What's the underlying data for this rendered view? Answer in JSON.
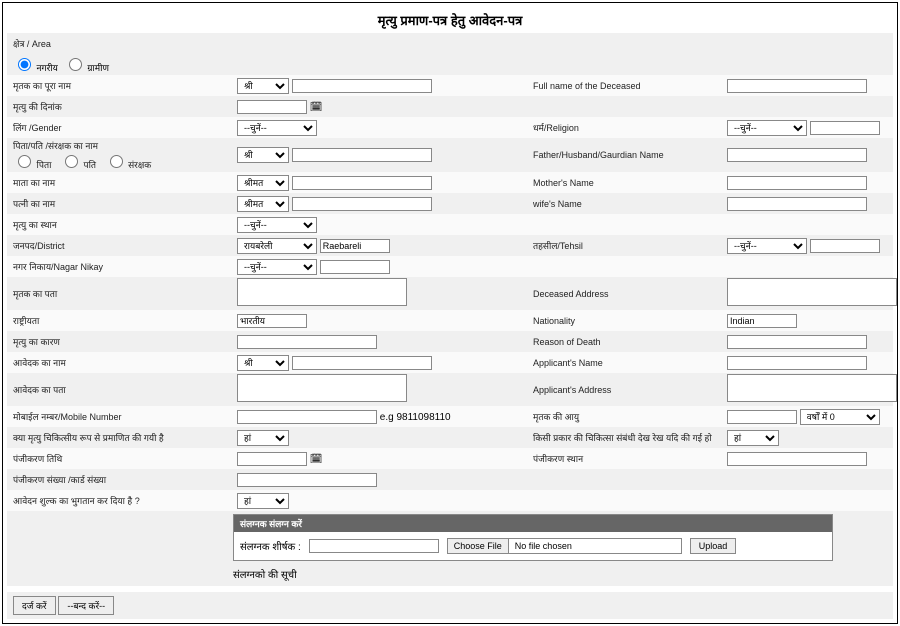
{
  "title": "मृत्यु प्रमाण-पत्र हेतु आवेदन-पत्र",
  "area": {
    "label": "क्षेत्र / Area",
    "opt1": "नगरीय",
    "opt2": "ग्रामीण"
  },
  "r1": {
    "l": "मृतक का पूरा नाम",
    "prefix": "श्री",
    "l2": "Full name of the Deceased"
  },
  "r2": {
    "l": "मृत्यु की दिनांक"
  },
  "r3": {
    "l": "लिंग /Gender",
    "sel": "--चुनें--",
    "l2": "धर्म/Religion",
    "sel2": "--चुनें--"
  },
  "r4": {
    "l": "पिता/पति /संरक्षक का नाम",
    "o1": "पिता",
    "o2": "पति",
    "o3": "संरक्षक",
    "prefix": "श्री",
    "l2": "Father/Husband/Gaurdian Name"
  },
  "r5": {
    "l": "माता का नाम",
    "prefix": "श्रीमत",
    "l2": "Mother's Name"
  },
  "r6": {
    "l": "पत्नी का नाम",
    "prefix": "श्रीमत",
    "l2": "wife's Name"
  },
  "r7": {
    "l": "मृत्यु का स्थान",
    "sel": "--चुनें--"
  },
  "r8": {
    "l": "जनपद/District",
    "sel": "रायबरेली",
    "val": "Raebareli",
    "l2": "तहसील/Tehsil",
    "sel2": "--चुनें--"
  },
  "r9": {
    "l": "नगर निकाय/Nagar Nikay",
    "sel": "--चुनें--"
  },
  "r10": {
    "l": "मृतक का पता",
    "l2": "Deceased Address"
  },
  "r11": {
    "l": "राष्ट्रीयता",
    "val": "भारतीय",
    "l2": "Nationality",
    "val2": "Indian"
  },
  "r12": {
    "l": "मृत्यु का कारण",
    "l2": "Reason of Death"
  },
  "r13": {
    "l": "आवेदक का नाम",
    "prefix": "श्री",
    "l2": "Applicant's Name"
  },
  "r14": {
    "l": "आवेदक का पता",
    "l2": "Applicant's Address"
  },
  "r15": {
    "l": "मोबाईल नम्बर/Mobile Number",
    "hint": "e.g 9811098110",
    "l2": "मृतक की आयु",
    "unit": "वर्षों में 0"
  },
  "r16": {
    "l": "क्या मृत्यु चिकित्सीय रूप से प्रमाणित की गयी है",
    "sel": "हां",
    "l2": "किसी प्रकार की चिकित्सा संबंधी देख रेख यदि की गई हो",
    "sel2": "हां"
  },
  "r17": {
    "l": "पंजीकरण तिथि",
    "l2": "पंजीकरण स्थान"
  },
  "r18": {
    "l": "पंजीकरण संख्या /कार्ड संख्या"
  },
  "r19": {
    "l": "आवेदन शुल्क का भुगतान कर दिया है ?",
    "sel": "हां"
  },
  "attach": {
    "hdr": "संलग्नक संलग्न करें",
    "lbl": "संलग्नक शीर्षक :",
    "choose": "Choose File",
    "nofile": "No file chosen",
    "upload": "Upload",
    "list": "संलग्नको की सूची"
  },
  "btn": {
    "submit": "दर्ज करें",
    "close": "--बन्द करें--"
  }
}
